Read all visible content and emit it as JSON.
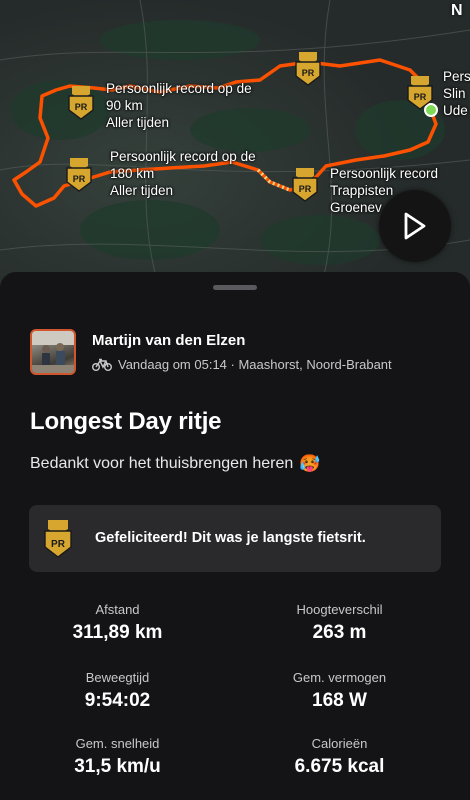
{
  "map": {
    "compass": "N",
    "pr_labels": [
      {
        "line1": "Persoonlijk record op de",
        "line2": "90 km",
        "line3": "Aller tijden"
      },
      {
        "line1": "Persoonlijk record op de",
        "line2": "180 km",
        "line3": "Aller tijden"
      },
      {
        "line1": "Persoonlijk record",
        "line2": "Trappisten",
        "line3": "Groenev"
      },
      {
        "line1": "Pers",
        "line2": "Slin",
        "line3": "Ude"
      }
    ],
    "badge_text": "PR",
    "colors": {
      "route": "#fc5200",
      "badge": "#d6a62f",
      "start": "#7ed957"
    }
  },
  "activity": {
    "athlete": "Martijn van den Elzen",
    "sport_icon": "bike-icon",
    "meta": "Vandaag om 05:14 · Maashorst, Noord-Brabant",
    "title": "Longest Day ritje",
    "description": "Bedankt voor het thuisbrengen heren",
    "emoji": "🥵"
  },
  "achievement": {
    "badge_text": "PR",
    "text": "Gefeliciteerd! Dit was je langste fietsrit."
  },
  "stats": [
    {
      "label": "Afstand",
      "value": "311,89 km"
    },
    {
      "label": "Hoogteverschil",
      "value": "263 m"
    },
    {
      "label": "Beweegtijd",
      "value": "9:54:02"
    },
    {
      "label": "Gem. vermogen",
      "value": "168 W"
    },
    {
      "label": "Gem. snelheid",
      "value": "31,5 km/u"
    },
    {
      "label": "Calorieën",
      "value": "6.675 kcal"
    }
  ]
}
